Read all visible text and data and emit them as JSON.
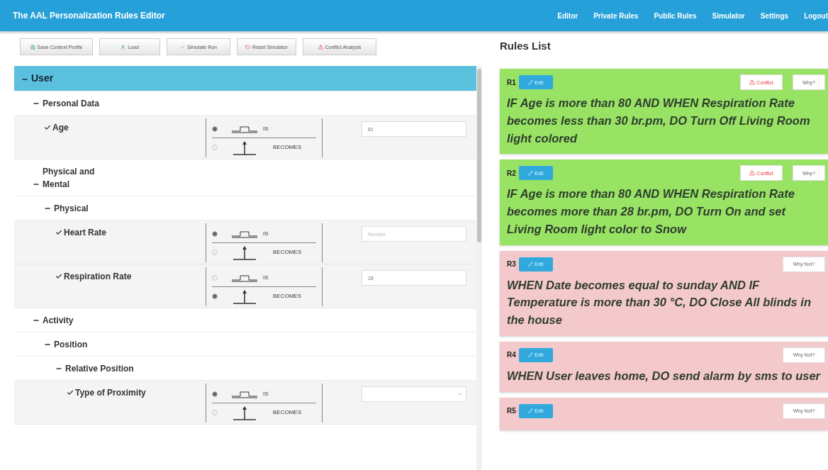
{
  "navbar": {
    "title": "The AAL Personalization Rules Editor",
    "links": [
      "Editor",
      "Private Rules",
      "Public Rules",
      "Simulator",
      "Settings",
      "Logout"
    ]
  },
  "toolbar": [
    {
      "kind": "save",
      "label": "Save Context Profile"
    },
    {
      "kind": "load",
      "label": "Load"
    },
    {
      "kind": "simulate",
      "label": "Simulate Run"
    },
    {
      "kind": "reset",
      "label": "Reset Simulator"
    },
    {
      "kind": "conflict",
      "label": "Conflict Analysis"
    }
  ],
  "tree": [
    {
      "kind": "group",
      "label": "User",
      "expanded": true,
      "selected": true,
      "children": [
        {
          "kind": "group",
          "label": "Personal Data",
          "expanded": true,
          "selected": false,
          "children": [
            {
              "kind": "variable",
              "label": "Age",
              "selected": false,
              "options": [
                {
                  "label": "IS",
                  "selected": true
                },
                {
                  "label": "BECOMES",
                  "selected": false
                }
              ],
              "input": {
                "kind": "text",
                "value": "81"
              }
            }
          ]
        },
        {
          "kind": "group",
          "label": "Physical and Mental",
          "expanded": true,
          "selected": false,
          "children": [
            {
              "kind": "group",
              "label": "Physical",
              "expanded": true,
              "selected": false,
              "children": [
                {
                  "kind": "variable",
                  "label": "Heart Rate",
                  "selected": false,
                  "options": [
                    {
                      "label": "IS",
                      "selected": true
                    },
                    {
                      "label": "BECOMES",
                      "selected": false
                    }
                  ],
                  "input": {
                    "kind": "text",
                    "placeholder": "Number"
                  }
                },
                {
                  "kind": "variable",
                  "label": "Respiration Rate",
                  "selected": false,
                  "options": [
                    {
                      "label": "IS",
                      "selected": false
                    },
                    {
                      "label": "BECOMES",
                      "selected": true
                    }
                  ],
                  "input": {
                    "kind": "text",
                    "value": "28"
                  }
                }
              ]
            }
          ]
        },
        {
          "kind": "group",
          "label": "Activity",
          "expanded": true,
          "selected": false,
          "children": [
            {
              "kind": "group",
              "label": "Position",
              "expanded": true,
              "selected": false,
              "children": [
                {
                  "kind": "group",
                  "label": "Relative Position",
                  "expanded": true,
                  "selected": false,
                  "children": [
                    {
                      "kind": "variable",
                      "label": "Type of Proximity",
                      "selected": false,
                      "options": [
                        {
                          "label": "IS",
                          "selected": true
                        },
                        {
                          "label": "BECOMES",
                          "selected": false
                        }
                      ],
                      "input": {
                        "kind": "select"
                      }
                    }
                  ]
                }
              ]
            }
          ]
        }
      ]
    }
  ],
  "rules_list": {
    "title": "Rules List",
    "rules": [
      {
        "id": "R1",
        "satisfied": true,
        "edit": "Edit",
        "buttons": [
          {
            "kind": "conflict",
            "label": "Conflict"
          },
          {
            "kind": "why",
            "label": "Why?"
          }
        ],
        "statement": "**IF** Age is more than 80 AND **WHEN** Respiration Rate becomes less than 30 br.pm, **DO** Turn Off Living Room light colored"
      },
      {
        "id": "R2",
        "satisfied": true,
        "edit": "Edit",
        "buttons": [
          {
            "kind": "conflict",
            "label": "Conflict"
          },
          {
            "kind": "why",
            "label": "Why?"
          }
        ],
        "statement": "**IF** Age is more than 80 AND **WHEN** Respiration Rate becomes more than 28 br.pm, **DO** Turn On and set Living Room light color to Snow"
      },
      {
        "id": "R3",
        "satisfied": false,
        "edit": "Edit",
        "buttons": [
          {
            "kind": "why",
            "label": "Why Not?"
          }
        ],
        "statement": "**WHEN** Date becomes equal to sunday AND **IF** Temperature is more than 30 °C, **DO** Close All blinds in the house"
      },
      {
        "id": "R4",
        "satisfied": false,
        "edit": "Edit",
        "buttons": [
          {
            "kind": "why",
            "label": "Why Not?"
          }
        ],
        "statement": "**WHEN** User leaves home, **DO** send alarm by sms to user"
      },
      {
        "id": "R5",
        "satisfied": false,
        "edit": "Edit",
        "buttons": [
          {
            "kind": "why",
            "label": "Why Not?"
          }
        ]
      }
    ]
  }
}
